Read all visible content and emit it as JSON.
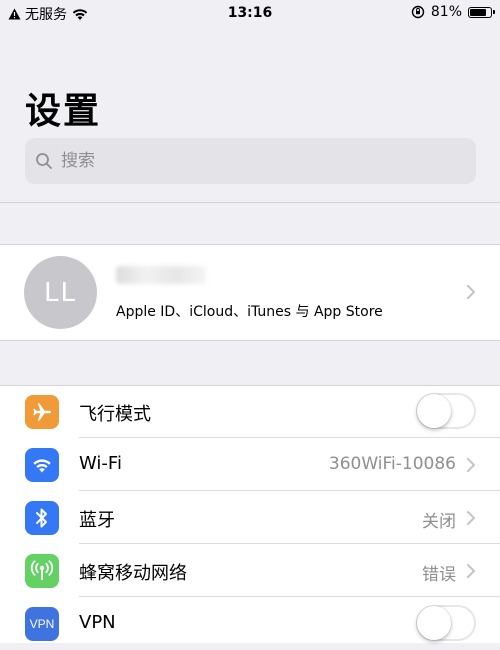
{
  "status_bar": {
    "carrier": "无服务",
    "time": "13:16",
    "battery_percent_label": "81%",
    "battery_level": 0.81
  },
  "page": {
    "title": "设置"
  },
  "search": {
    "placeholder": "搜索"
  },
  "account": {
    "avatar_initials": "LL",
    "subtitle": "Apple ID、iCloud、iTunes 与 App Store"
  },
  "settings": {
    "airplane": {
      "label": "飞行模式",
      "icon": "airplane-icon",
      "color": "#f19a38",
      "toggle_on": false
    },
    "wifi": {
      "label": "Wi-Fi",
      "value": "360WiFi-10086",
      "icon": "wifi-icon",
      "color": "#3478f6"
    },
    "bluetooth": {
      "label": "蓝牙",
      "value": "关闭",
      "icon": "bluetooth-icon",
      "color": "#3478f6"
    },
    "cellular": {
      "label": "蜂窝移动网络",
      "value": "错误",
      "icon": "cellular-icon",
      "color": "#64d164"
    },
    "vpn": {
      "label": "VPN",
      "icon_text": "VPN",
      "color": "#3f74e0",
      "toggle_on": false
    }
  }
}
